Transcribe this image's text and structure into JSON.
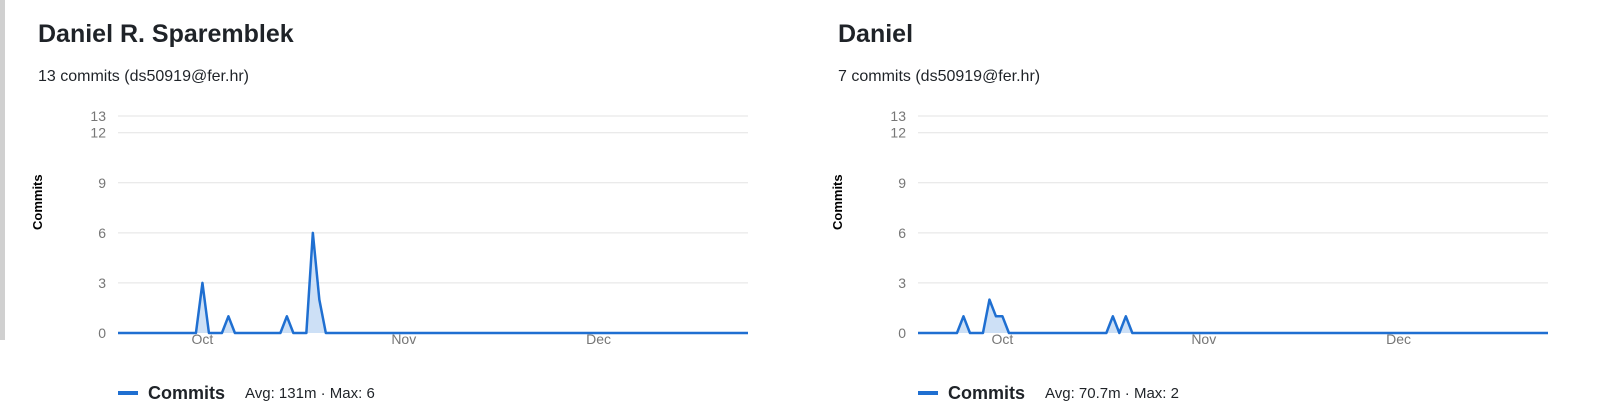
{
  "colors": {
    "series": "#1f6fd1",
    "area": "#cde0f6",
    "grid": "#e3e3e3",
    "axis": "#767676"
  },
  "panels": [
    {
      "author": "Daniel R. Sparemblek",
      "commits_line": "13 commits (ds50919@fer.hr)",
      "legend": {
        "label": "Commits",
        "avg": "Avg: 131m",
        "sep": " · ",
        "max": "Max: 6"
      }
    },
    {
      "author": "Daniel",
      "commits_line": "7 commits (ds50919@fer.hr)",
      "legend": {
        "label": "Commits",
        "avg": "Avg: 70.7m",
        "sep": " · ",
        "max": "Max: 2"
      }
    }
  ],
  "chart_data": [
    {
      "type": "area",
      "ylabel": "Commits",
      "ylim": [
        0,
        13
      ],
      "yticks": [
        0,
        3,
        6,
        9,
        12,
        13
      ],
      "x_tick_labels": [
        "Oct",
        "Nov",
        "Dec"
      ],
      "x_ticks_day": [
        30,
        61,
        91
      ],
      "xlim_day": [
        17,
        114
      ],
      "grid": true,
      "series": [
        {
          "name": "Commits",
          "points": [
            [
              17,
              0
            ],
            [
              29,
              0
            ],
            [
              30,
              3
            ],
            [
              31,
              0
            ],
            [
              33,
              0
            ],
            [
              34,
              1
            ],
            [
              35,
              0
            ],
            [
              42,
              0
            ],
            [
              43,
              1
            ],
            [
              44,
              0
            ],
            [
              46,
              0
            ],
            [
              47,
              6
            ],
            [
              48,
              2
            ],
            [
              49,
              0
            ],
            [
              114,
              0
            ]
          ]
        }
      ]
    },
    {
      "type": "area",
      "ylabel": "Commits",
      "ylim": [
        0,
        13
      ],
      "yticks": [
        0,
        3,
        6,
        9,
        12,
        13
      ],
      "x_tick_labels": [
        "Oct",
        "Nov",
        "Dec"
      ],
      "x_ticks_day": [
        30,
        61,
        91
      ],
      "xlim_day": [
        17,
        114
      ],
      "grid": true,
      "series": [
        {
          "name": "Commits",
          "points": [
            [
              17,
              0
            ],
            [
              23,
              0
            ],
            [
              24,
              1
            ],
            [
              25,
              0
            ],
            [
              27,
              0
            ],
            [
              28,
              2
            ],
            [
              29,
              1
            ],
            [
              30,
              1
            ],
            [
              31,
              0
            ],
            [
              46,
              0
            ],
            [
              47,
              1
            ],
            [
              48,
              0
            ],
            [
              49,
              1
            ],
            [
              50,
              0
            ],
            [
              114,
              0
            ]
          ]
        }
      ]
    }
  ]
}
